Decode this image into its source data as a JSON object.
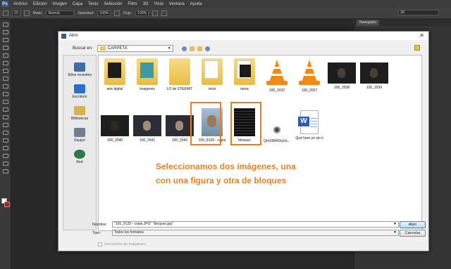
{
  "app": {
    "logo": "Ps",
    "menu": [
      "Archivo",
      "Edición",
      "Imagen",
      "Capa",
      "Texto",
      "Selección",
      "Filtro",
      "3D",
      "Vista",
      "Ventana",
      "Ayuda"
    ]
  },
  "options_bar": {
    "brush_size": "13",
    "mode_label": "Modo:",
    "mode_value": "Normal",
    "opacity_label": "Opacidad:",
    "opacity_value": "100%",
    "flow_label": "Flujo:",
    "flow_value": "100%",
    "workspace": "3D"
  },
  "panel": {
    "tab": "Navegador"
  },
  "dialog": {
    "title": "Abrir",
    "look_in_label": "Buscar en:",
    "look_in_value": "CARPETA",
    "places": [
      "Sitios recientes",
      "Escritorio",
      "Bibliotecas",
      "Equipo",
      "Red"
    ],
    "files": [
      {
        "name": "arte digital",
        "kind": "folder-dark"
      },
      {
        "name": "imagenes",
        "kind": "folder-teal"
      },
      {
        "name": "LO de STEEMIT",
        "kind": "folder"
      },
      {
        "name": "otros",
        "kind": "folder-paper"
      },
      {
        "name": "tarea",
        "kind": "folder-dark"
      },
      {
        "name": "100_1932",
        "kind": "vlc"
      },
      {
        "name": "100_2037",
        "kind": "vlc"
      },
      {
        "name": "100_2038",
        "kind": "photo"
      },
      {
        "name": "100_2039",
        "kind": "photo"
      },
      {
        "name": "100_2040",
        "kind": "photo"
      },
      {
        "name": "100_2041",
        "kind": "photo"
      },
      {
        "name": "100_2042",
        "kind": "photo"
      },
      {
        "name": "100_9129 - copia",
        "kind": "portrait"
      },
      {
        "name": "bloques",
        "kind": "blocks"
      },
      {
        "name": "QmXRbN2q1ts...",
        "kind": "sun"
      },
      {
        "name": "Qué hare yo sin ti",
        "kind": "word"
      }
    ],
    "annotation_line1": "Seleccionamos dos imágenes, una",
    "annotation_line2": "con una figura y otra de bloques",
    "name_label": "Nombre:",
    "name_value": "\"100_9129 - copia.JPG\" \"bloques.jpg\"",
    "type_label": "Tipo:",
    "type_value": "Todos los formatos",
    "open_button": "Abrir",
    "cancel_button": "Cancelar",
    "sequence_label": "Secuencia de imágenes"
  }
}
